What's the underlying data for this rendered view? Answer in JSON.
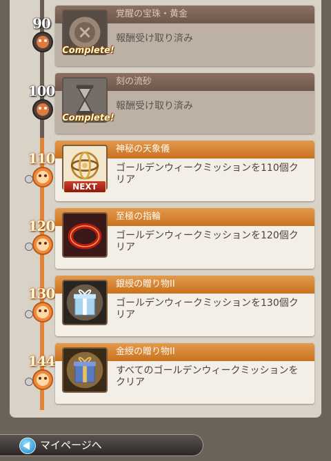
{
  "missions": [
    {
      "milestone": "90",
      "title": "覚醒の宝珠・黄金",
      "description": "報酬受け取り済み",
      "status": "complete",
      "badge": "Complete!",
      "item_icon": "awakening-orb-gold-icon"
    },
    {
      "milestone": "100",
      "title": "刻の流砂",
      "description": "報酬受け取り済み",
      "status": "complete",
      "badge": "Complete!",
      "item_icon": "hourglass-sand-icon"
    },
    {
      "milestone": "110",
      "title": "神秘の天象儀",
      "description": "ゴールデンウィークミッションを110個クリア",
      "status": "next",
      "badge": "NEXT",
      "item_icon": "armillary-sphere-icon"
    },
    {
      "milestone": "120",
      "title": "至極の指輪",
      "description": "ゴールデンウィークミッションを120個クリア",
      "status": "pending",
      "badge": "",
      "item_icon": "red-ring-icon"
    },
    {
      "milestone": "130",
      "title": "銀綬の贈り物II",
      "description": "ゴールデンウィークミッションを130個クリア",
      "status": "pending",
      "badge": "",
      "item_icon": "silver-gift-box-icon"
    },
    {
      "milestone": "144",
      "title": "金綬の贈り物II",
      "description": "すべてのゴールデンウィークミッションをクリア",
      "status": "pending",
      "badge": "",
      "item_icon": "gold-gift-box-icon"
    }
  ],
  "footer": {
    "back_label": "マイページへ"
  },
  "colors": {
    "complete_header": "#7a6253",
    "pending_header": "#d9832f",
    "track_done": "#6a5d55",
    "track_pending": "#e0843a"
  }
}
